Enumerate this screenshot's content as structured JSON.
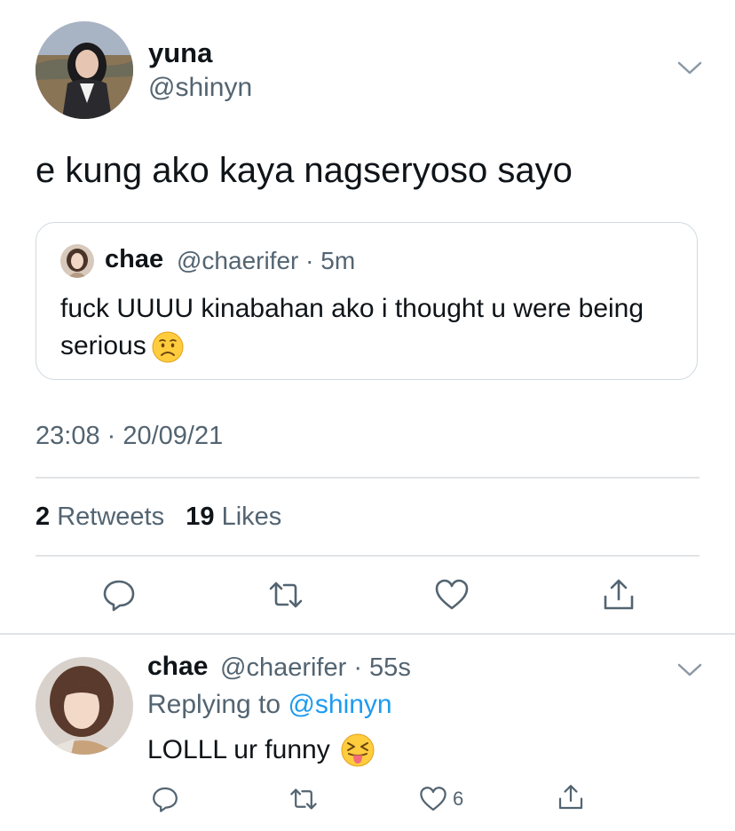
{
  "tweet": {
    "author_name": "yuna",
    "author_handle": "@shinyn",
    "text": "e kung ako kaya nagseryoso sayo",
    "timestamp": "23:08 · 20/09/21",
    "retweets_count": "2",
    "retweets_label": "Retweets",
    "likes_count": "19",
    "likes_label": "Likes"
  },
  "quote": {
    "author_name": "chae",
    "author_handle": "@chaerifer",
    "time": "· 5m",
    "text": "fuck UUUU kinabahan ako i thought u were being serious"
  },
  "reply": {
    "author_name": "chae",
    "author_handle": "@chaerifer",
    "time": "· 55s",
    "replying_prefix": "Replying to",
    "replying_mention": "@shinyn",
    "text": "LOLLL ur funny",
    "like_count": "6"
  },
  "colors": {
    "text_primary": "#0f1419",
    "text_secondary": "#536471",
    "link": "#1d9bf0",
    "divider": "#e1e4e6"
  }
}
